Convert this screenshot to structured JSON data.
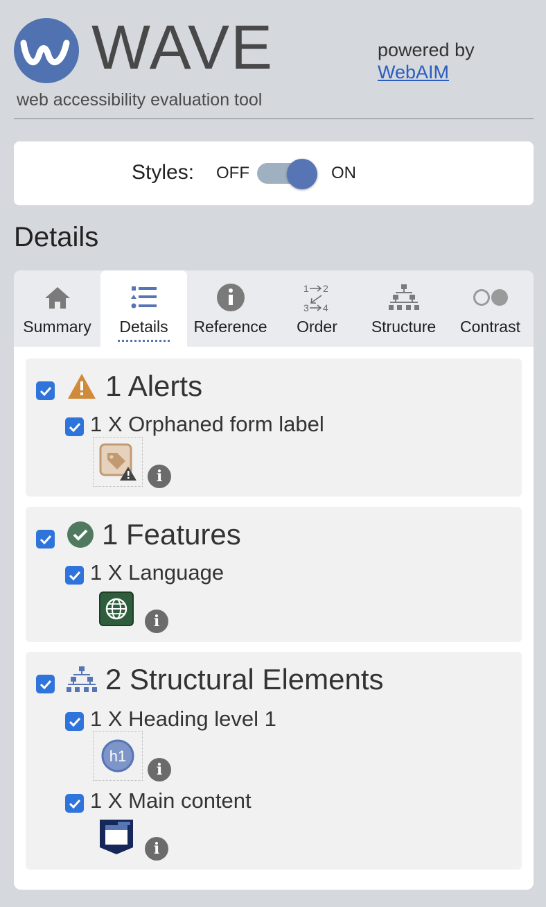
{
  "header": {
    "logo_word": "WAVE",
    "tagline": "web accessibility evaluation tool",
    "powered_by": "powered by",
    "webaim_link": "WebAIM"
  },
  "styles_toggle": {
    "label": "Styles:",
    "off": "OFF",
    "on": "ON",
    "state": "on"
  },
  "section_title": "Details",
  "tabs": [
    {
      "label": "Summary",
      "icon": "home-icon"
    },
    {
      "label": "Details",
      "icon": "list-icon",
      "active": true
    },
    {
      "label": "Reference",
      "icon": "info-icon"
    },
    {
      "label": "Order",
      "icon": "order-icon"
    },
    {
      "label": "Structure",
      "icon": "hierarchy-icon"
    },
    {
      "label": "Contrast",
      "icon": "contrast-icon"
    }
  ],
  "groups": [
    {
      "title": "1 Alerts",
      "icon": "alert-triangle-icon",
      "items": [
        {
          "label": "1 X Orphaned form label",
          "icon": "orphaned-label-icon"
        }
      ]
    },
    {
      "title": "1 Features",
      "icon": "check-circle-icon",
      "items": [
        {
          "label": "1 X Language",
          "icon": "globe-icon"
        }
      ]
    },
    {
      "title": "2 Structural Elements",
      "icon": "hierarchy-icon",
      "items": [
        {
          "label": "1 X Heading level 1",
          "icon": "h1-icon",
          "icon_text": "h1"
        },
        {
          "label": "1 X Main content",
          "icon": "main-content-icon"
        }
      ]
    }
  ],
  "colors": {
    "accent": "#5774b4",
    "checkbox": "#2f74da",
    "alert": "#d08a3c",
    "feature": "#4f7a60",
    "link": "#2a5dbf"
  }
}
